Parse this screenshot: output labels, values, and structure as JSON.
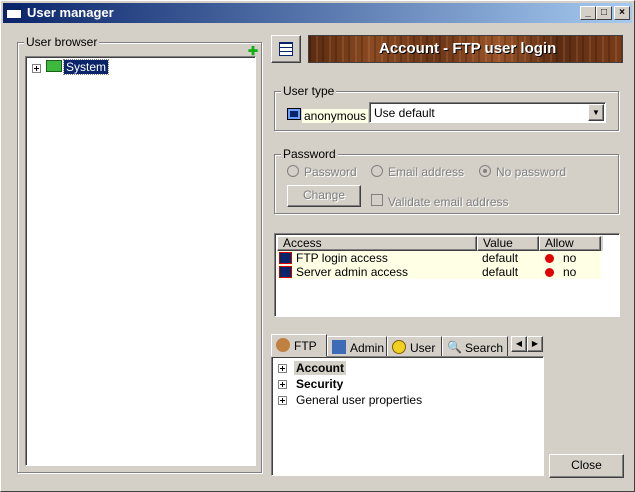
{
  "window": {
    "title": "User manager"
  },
  "title_buttons": {
    "minimize": "_",
    "maximize": "□",
    "close": "×"
  },
  "user_browser": {
    "label": "User browser",
    "root": {
      "label": "System"
    }
  },
  "banner": {
    "text": "Account - FTP user login"
  },
  "user_type": {
    "label": "User type",
    "user_name": "anonymous",
    "select_value": "Use default"
  },
  "password": {
    "label": "Password",
    "options": [
      "Password",
      "Email address",
      "No password"
    ],
    "change_label": "Change",
    "validate_label": "Validate email address"
  },
  "access_table": {
    "columns": [
      "Access",
      "Value",
      "Allow"
    ],
    "rows": [
      {
        "access": "FTP login access",
        "value": "default",
        "allow": "no"
      },
      {
        "access": "Server admin access",
        "value": "default",
        "allow": "no"
      }
    ]
  },
  "tabs": [
    "FTP",
    "Admin",
    "User",
    "Search"
  ],
  "ftp_tree": [
    "Account",
    "Security",
    "General user properties"
  ],
  "close_label": "Close",
  "colors": {
    "title_start": "#0a246a",
    "title_end": "#a6caf0",
    "row_highlight": "#ffffe6",
    "allow_dot": "#e00000"
  }
}
